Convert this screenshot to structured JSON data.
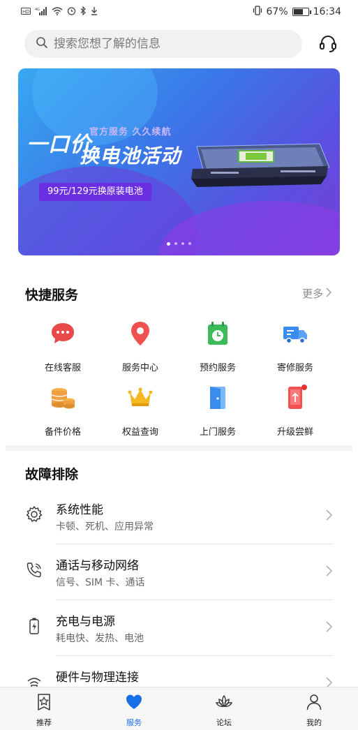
{
  "status_bar": {
    "left_icons": [
      "hd-icon",
      "signal-4g-icon",
      "wifi-icon",
      "alarm-icon",
      "bluetooth-icon",
      "download-icon"
    ],
    "battery_percent": "67%",
    "battery_level": 0.67,
    "time": "16:34"
  },
  "search": {
    "placeholder": "搜索您想了解的信息"
  },
  "banner": {
    "title_line1": "一口价",
    "subtitle": "官方服务 久久续航",
    "title_line2": "换电池活动",
    "tag": "99元/129元换原装电池",
    "page_count": 4,
    "active_page": 1
  },
  "quick_services": {
    "title": "快捷服务",
    "more": "更多",
    "items": [
      {
        "label": "在线客服",
        "icon": "chat-bubble-icon",
        "color": "#e84a4a"
      },
      {
        "label": "服务中心",
        "icon": "location-pin-icon",
        "color": "#f05050"
      },
      {
        "label": "预约服务",
        "icon": "calendar-clock-icon",
        "color": "#3dbb5a"
      },
      {
        "label": "寄修服务",
        "icon": "delivery-truck-icon",
        "color": "#3a8cf0"
      },
      {
        "label": "备件价格",
        "icon": "coins-icon",
        "color": "#f0a040"
      },
      {
        "label": "权益查询",
        "icon": "crown-icon",
        "color": "#f5b820"
      },
      {
        "label": "上门服务",
        "icon": "door-icon",
        "color": "#3a8cf0"
      },
      {
        "label": "升级尝鲜",
        "icon": "phone-upgrade-icon",
        "color": "#f05050"
      }
    ]
  },
  "troubleshooting": {
    "title": "故障排除",
    "items": [
      {
        "title": "系统性能",
        "desc": "卡顿、死机、应用异常",
        "icon": "gear-icon"
      },
      {
        "title": "通话与移动网络",
        "desc": "信号、SIM 卡、通话",
        "icon": "phone-call-icon"
      },
      {
        "title": "充电与电源",
        "desc": "耗电快、发热、电池",
        "icon": "battery-charge-icon"
      },
      {
        "title": "硬件与物理连接",
        "desc": "",
        "icon": "hardware-connect-icon"
      }
    ]
  },
  "bottom_nav": {
    "items": [
      {
        "label": "推荐",
        "icon": "star-badge-icon"
      },
      {
        "label": "服务",
        "icon": "heart-icon",
        "active": true
      },
      {
        "label": "论坛",
        "icon": "lotus-icon"
      },
      {
        "label": "我的",
        "icon": "person-icon"
      }
    ]
  },
  "colors": {
    "accent": "#1a6fe8",
    "banner_tag": "#6a2fe0"
  }
}
